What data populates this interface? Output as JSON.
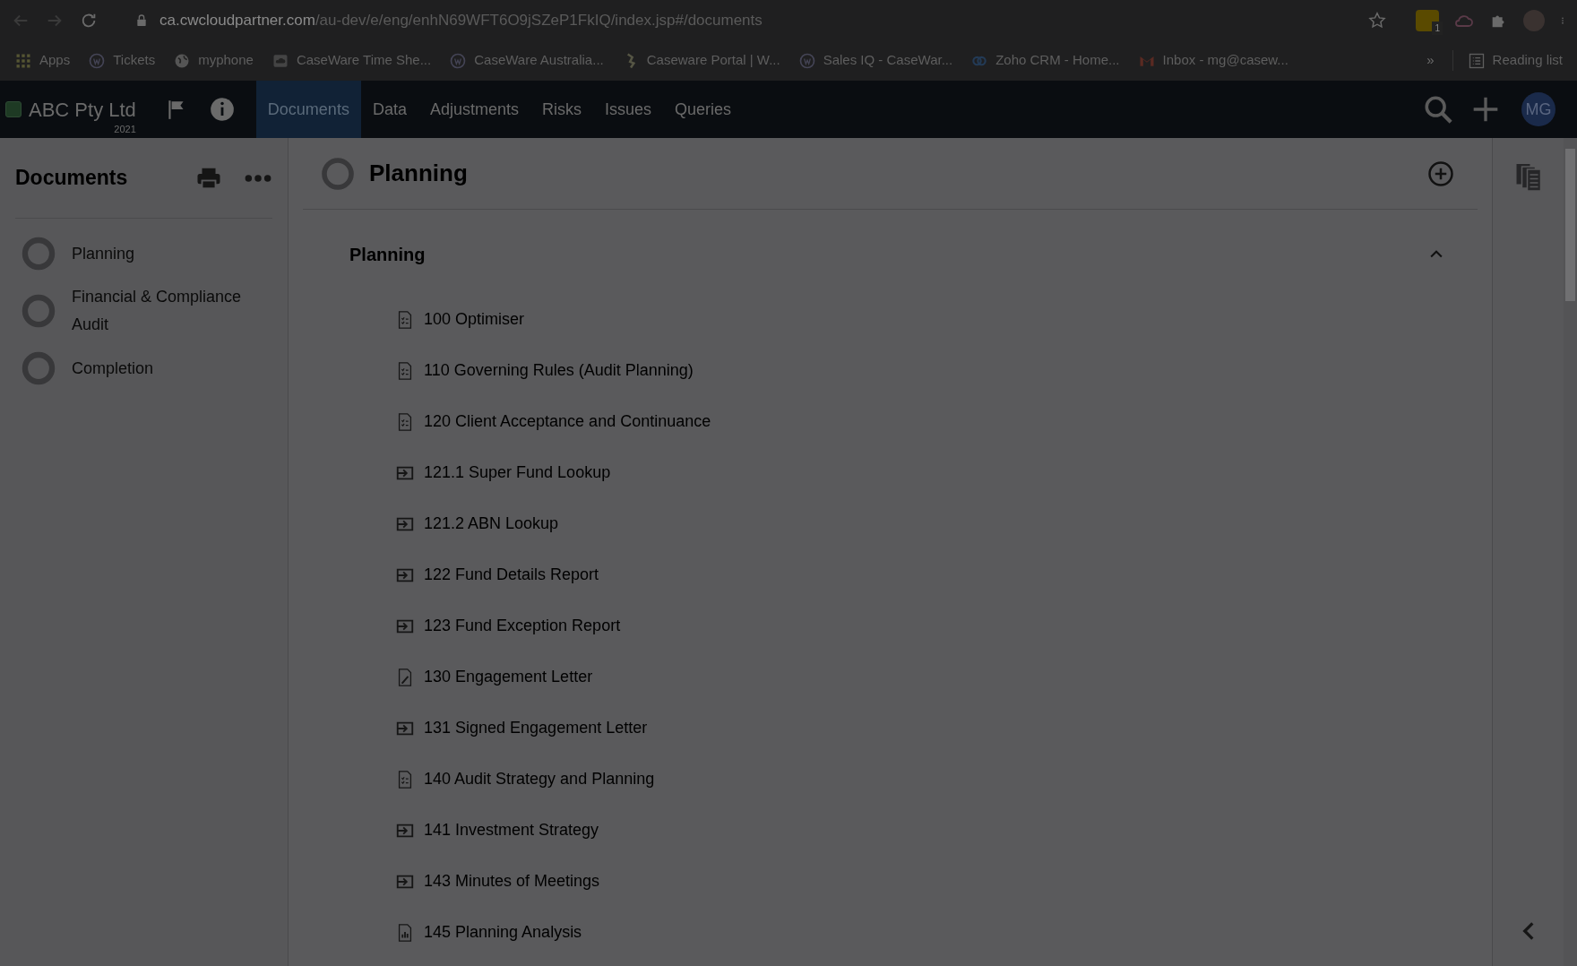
{
  "browser": {
    "url_host": "ca.cwcloudpartner.com",
    "url_path": "/au-dev/e/eng/enhN69WFT6O9jSZeP1FkIQ/index.jsp#/documents",
    "extension_badge": "1",
    "bookmarks": [
      {
        "label": "Apps",
        "kind": "apps"
      },
      {
        "label": "Tickets",
        "kind": "cw"
      },
      {
        "label": "myphone",
        "kind": "globe"
      },
      {
        "label": "CaseWare Time She...",
        "kind": "cloud"
      },
      {
        "label": "CaseWare Australia...",
        "kind": "cw"
      },
      {
        "label": "Caseware Portal | W...",
        "kind": "portal"
      },
      {
        "label": "Sales IQ - CaseWar...",
        "kind": "cw"
      },
      {
        "label": "Zoho CRM - Home...",
        "kind": "zoho"
      },
      {
        "label": "Inbox - mg@casew...",
        "kind": "mail"
      }
    ],
    "overflow": "»",
    "reading_list": "Reading list"
  },
  "app": {
    "client": "ABC Pty Ltd",
    "year": "2021",
    "tabs": [
      {
        "label": "Documents",
        "selected": true
      },
      {
        "label": "Data",
        "selected": false
      },
      {
        "label": "Adjustments",
        "selected": false
      },
      {
        "label": "Risks",
        "selected": false
      },
      {
        "label": "Issues",
        "selected": false
      },
      {
        "label": "Queries",
        "selected": false
      }
    ],
    "avatar": "MG"
  },
  "sidebar": {
    "title": "Documents",
    "items": [
      {
        "label": "Planning"
      },
      {
        "label": "Financial & Compliance Audit"
      },
      {
        "label": "Completion"
      }
    ]
  },
  "main": {
    "title": "Planning",
    "section": {
      "title": "Planning",
      "expanded": true,
      "documents": [
        {
          "label": "100 Optimiser",
          "kind": "checklist"
        },
        {
          "label": "110 Governing Rules (Audit Planning)",
          "kind": "checklist"
        },
        {
          "label": "120 Client Acceptance and Continuance",
          "kind": "checklist"
        },
        {
          "label": "121.1 Super Fund Lookup",
          "kind": "input"
        },
        {
          "label": "121.2 ABN Lookup",
          "kind": "input"
        },
        {
          "label": "122 Fund Details Report",
          "kind": "input"
        },
        {
          "label": "123 Fund Exception Report",
          "kind": "input"
        },
        {
          "label": "130 Engagement Letter",
          "kind": "letter"
        },
        {
          "label": "131 Signed Engagement Letter",
          "kind": "input"
        },
        {
          "label": "140 Audit Strategy and Planning",
          "kind": "checklist"
        },
        {
          "label": "141 Investment Strategy",
          "kind": "input"
        },
        {
          "label": "143 Minutes of Meetings",
          "kind": "input"
        },
        {
          "label": "145 Planning Analysis",
          "kind": "analysis"
        }
      ]
    }
  }
}
